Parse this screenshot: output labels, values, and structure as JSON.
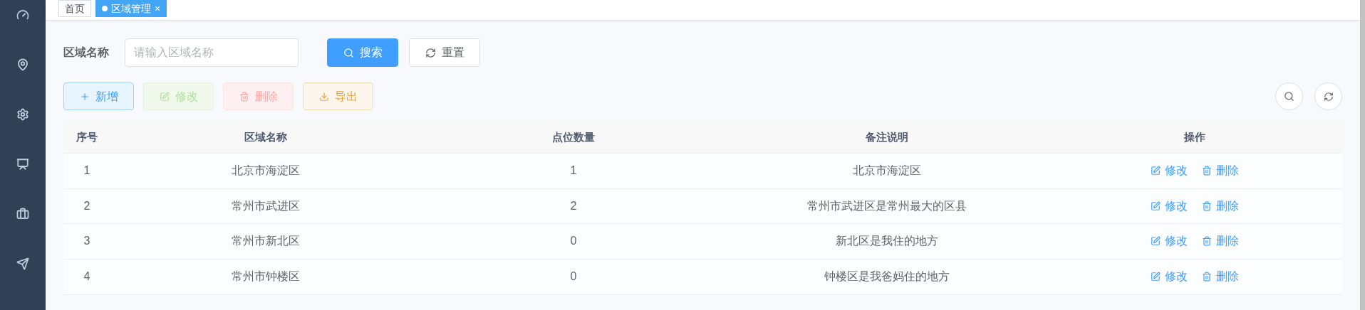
{
  "sidebar": {
    "items": [
      {
        "kind": "gauge",
        "selected": false
      },
      {
        "kind": "pin",
        "selected": false
      },
      {
        "kind": "gear",
        "selected": false
      },
      {
        "kind": "monitor",
        "selected": false
      },
      {
        "kind": "briefcase",
        "selected": false
      },
      {
        "kind": "plane",
        "selected": false
      }
    ]
  },
  "tags": [
    {
      "label": "首页",
      "selected": false
    },
    {
      "label": "区域管理",
      "selected": true,
      "close": "×"
    }
  ],
  "search_form": {
    "label": "区域名称",
    "placeholder": "请输入区域名称",
    "buttons": [
      {
        "label": "搜索",
        "kind": "primary"
      },
      {
        "label": "重置",
        "kind": "default"
      }
    ]
  },
  "toolbar": [
    {
      "label": "新增",
      "kind": "add",
      "disabled": false
    },
    {
      "label": "修改",
      "kind": "edit",
      "disabled": true
    },
    {
      "label": "删除",
      "kind": "delete",
      "disabled": true
    },
    {
      "label": "导出",
      "kind": "export",
      "disabled": false
    }
  ],
  "table": {
    "columns": [
      "序号",
      "区域名称",
      "点位数量",
      "备注说明",
      "操作"
    ],
    "rows": [
      {
        "cells": [
          "1",
          "北京市海淀区",
          "1",
          "北京市海淀区"
        ],
        "actions": [
          "修改",
          "删除"
        ]
      },
      {
        "cells": [
          "2",
          "常州市武进区",
          "2",
          "常州市武进区是常州最大的区县"
        ],
        "actions": [
          "修改",
          "删除"
        ]
      },
      {
        "cells": [
          "3",
          "常州市新北区",
          "0",
          "新北区是我住的地方"
        ],
        "actions": [
          "修改",
          "删除"
        ]
      },
      {
        "cells": [
          "4",
          "常州市钟楼区",
          "0",
          "钟楼区是我爸妈住的地方"
        ],
        "actions": [
          "修改",
          "删除"
        ]
      }
    ]
  }
}
